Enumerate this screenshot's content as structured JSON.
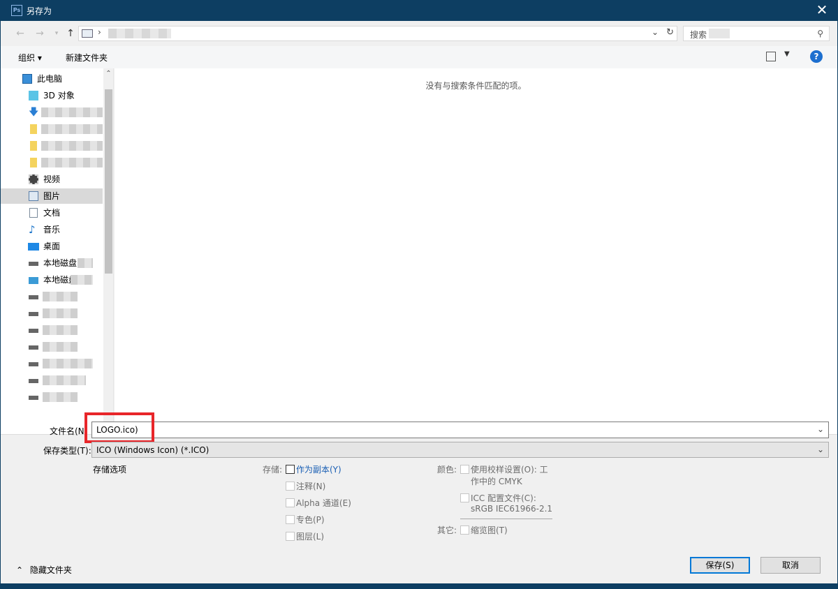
{
  "window": {
    "title": "另存为",
    "app_icon": "Ps",
    "close_icon": "close-icon"
  },
  "address": {
    "separator": "›",
    "dropdown_icon": "chevron-down-icon",
    "refresh_icon": "refresh-icon"
  },
  "search": {
    "placeholder": "搜索",
    "icon": "search-icon"
  },
  "toolbar": {
    "organize": "组织 ▾",
    "new_folder": "新建文件夹",
    "help": "?"
  },
  "nav": {
    "items": [
      {
        "label": "此电脑",
        "icon": "computer-icon"
      },
      {
        "label": "3D 对象",
        "icon": "cube-icon"
      },
      {
        "label": "",
        "icon": "download-icon"
      },
      {
        "label": "",
        "icon": "folder-icon"
      },
      {
        "label": "",
        "icon": "folder-icon"
      },
      {
        "label": "",
        "icon": "folder-icon"
      },
      {
        "label": "视频",
        "icon": "video-icon"
      },
      {
        "label": "图片",
        "icon": "picture-icon"
      },
      {
        "label": "文档",
        "icon": "document-icon"
      },
      {
        "label": "音乐",
        "icon": "music-icon"
      },
      {
        "label": "桌面",
        "icon": "desktop-icon"
      },
      {
        "label": "本地磁盘",
        "icon": "drive-icon"
      },
      {
        "label": "本地磁盘",
        "icon": "network-drive-icon"
      }
    ]
  },
  "content": {
    "empty_message": "没有与搜索条件匹配的项。"
  },
  "form": {
    "filename_label": "文件名(N:",
    "filename_value": "LOGO.ico)",
    "filetype_label": "保存类型(T):",
    "filetype_value": "ICO (Windows Icon) (*.ICO)"
  },
  "options": {
    "title": "存储选项",
    "save_label": "存储:",
    "as_copy": "作为副本(Y)",
    "notes": "注释(N)",
    "alpha": "Alpha 通道(E)",
    "spot": "专色(P)",
    "layers": "图层(L)",
    "color_label": "颜色:",
    "proof_line1": "使用校样设置(O):  工",
    "proof_line2": "作中的 CMYK",
    "icc_line1": "ICC 配置文件(C):",
    "icc_line2": "sRGB IEC61966-2.1",
    "other_label": "其它:",
    "thumbnail": "缩览图(T)"
  },
  "footer": {
    "hide_folders": "隐藏文件夹",
    "save": "保存(S)",
    "cancel": "取消"
  },
  "colors": {
    "titlebar": "#0d3e62",
    "accent": "#0078d7",
    "highlight": "#e8262a"
  }
}
